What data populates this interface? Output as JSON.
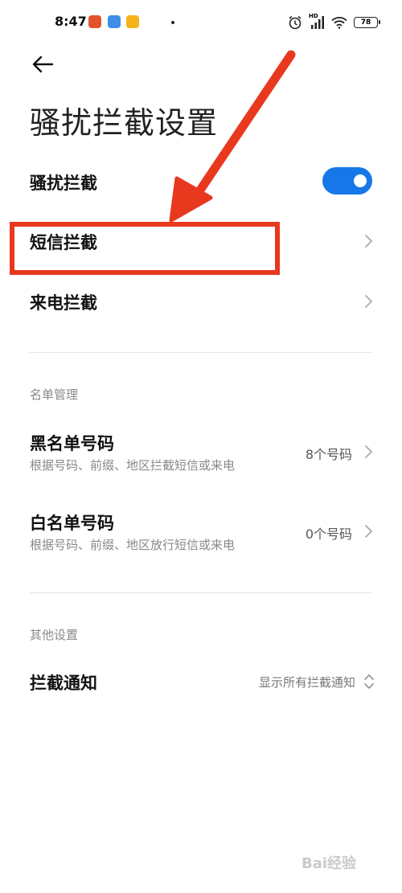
{
  "status_bar": {
    "time": "8:47",
    "battery": "78",
    "network": "HD"
  },
  "page": {
    "title": "骚扰拦截设置"
  },
  "rows": {
    "harassment_block": {
      "label": "骚扰拦截",
      "enabled": true
    },
    "sms_block": {
      "label": "短信拦截"
    },
    "call_block": {
      "label": "来电拦截"
    }
  },
  "list_management": {
    "header": "名单管理",
    "blacklist": {
      "label": "黑名单号码",
      "subtitle": "根据号码、前缀、地区拦截短信或来电",
      "value": "8个号码"
    },
    "whitelist": {
      "label": "白名单号码",
      "subtitle": "根据号码、前缀、地区放行短信或来电",
      "value": "0个号码"
    }
  },
  "other_settings": {
    "header": "其他设置",
    "block_notification": {
      "label": "拦截通知",
      "value": "显示所有拦截通知"
    }
  },
  "watermark": "Bai经验",
  "colors": {
    "accent": "#1677e8",
    "annotation": "#e8391f"
  }
}
